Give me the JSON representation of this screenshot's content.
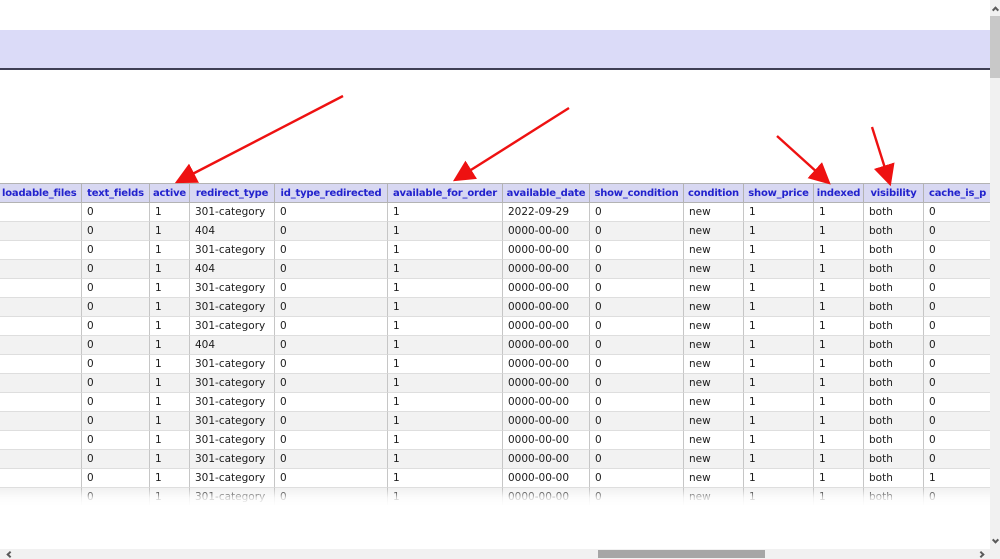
{
  "banner": {
    "background_color": "#dbdbf8",
    "border_color": "#3f3f55"
  },
  "table": {
    "header_bg": "#d8d8f2",
    "header_text_color": "#2222cd",
    "alt_row_bg": "#f2f2f2",
    "columns": [
      "loadable_files",
      "text_fields",
      "active",
      "redirect_type",
      "id_type_redirected",
      "available_for_order",
      "available_date",
      "show_condition",
      "condition",
      "show_price",
      "indexed",
      "visibility",
      "cache_is_p"
    ],
    "rows": [
      [
        "",
        "0",
        "1",
        "301-category",
        "0",
        "1",
        "2022-09-29",
        "0",
        "new",
        "1",
        "1",
        "both",
        "0"
      ],
      [
        "",
        "0",
        "1",
        "404",
        "0",
        "1",
        "0000-00-00",
        "0",
        "new",
        "1",
        "1",
        "both",
        "0"
      ],
      [
        "",
        "0",
        "1",
        "301-category",
        "0",
        "1",
        "0000-00-00",
        "0",
        "new",
        "1",
        "1",
        "both",
        "0"
      ],
      [
        "",
        "0",
        "1",
        "404",
        "0",
        "1",
        "0000-00-00",
        "0",
        "new",
        "1",
        "1",
        "both",
        "0"
      ],
      [
        "",
        "0",
        "1",
        "301-category",
        "0",
        "1",
        "0000-00-00",
        "0",
        "new",
        "1",
        "1",
        "both",
        "0"
      ],
      [
        "",
        "0",
        "1",
        "301-category",
        "0",
        "1",
        "0000-00-00",
        "0",
        "new",
        "1",
        "1",
        "both",
        "0"
      ],
      [
        "",
        "0",
        "1",
        "301-category",
        "0",
        "1",
        "0000-00-00",
        "0",
        "new",
        "1",
        "1",
        "both",
        "0"
      ],
      [
        "",
        "0",
        "1",
        "404",
        "0",
        "1",
        "0000-00-00",
        "0",
        "new",
        "1",
        "1",
        "both",
        "0"
      ],
      [
        "",
        "0",
        "1",
        "301-category",
        "0",
        "1",
        "0000-00-00",
        "0",
        "new",
        "1",
        "1",
        "both",
        "0"
      ],
      [
        "",
        "0",
        "1",
        "301-category",
        "0",
        "1",
        "0000-00-00",
        "0",
        "new",
        "1",
        "1",
        "both",
        "0"
      ],
      [
        "",
        "0",
        "1",
        "301-category",
        "0",
        "1",
        "0000-00-00",
        "0",
        "new",
        "1",
        "1",
        "both",
        "0"
      ],
      [
        "",
        "0",
        "1",
        "301-category",
        "0",
        "1",
        "0000-00-00",
        "0",
        "new",
        "1",
        "1",
        "both",
        "0"
      ],
      [
        "",
        "0",
        "1",
        "301-category",
        "0",
        "1",
        "0000-00-00",
        "0",
        "new",
        "1",
        "1",
        "both",
        "0"
      ],
      [
        "",
        "0",
        "1",
        "301-category",
        "0",
        "1",
        "0000-00-00",
        "0",
        "new",
        "1",
        "1",
        "both",
        "0"
      ],
      [
        "",
        "0",
        "1",
        "301-category",
        "0",
        "1",
        "0000-00-00",
        "0",
        "new",
        "1",
        "1",
        "both",
        "1"
      ],
      [
        "",
        "0",
        "1",
        "301-category",
        "0",
        "1",
        "0000-00-00",
        "0",
        "new",
        "1",
        "1",
        "both",
        "0"
      ]
    ]
  },
  "annotations": {
    "arrow_color": "#ee1111",
    "arrows": [
      {
        "target_column": "active"
      },
      {
        "target_column": "available_for_order"
      },
      {
        "target_column": "indexed"
      },
      {
        "target_column": "visibility"
      }
    ]
  },
  "scrollbars": {
    "vertical": {
      "icons": [
        "chevron-up-icon",
        "chevron-down-icon"
      ]
    },
    "horizontal": {
      "icons": [
        "chevron-left-icon",
        "chevron-right-icon"
      ]
    }
  }
}
